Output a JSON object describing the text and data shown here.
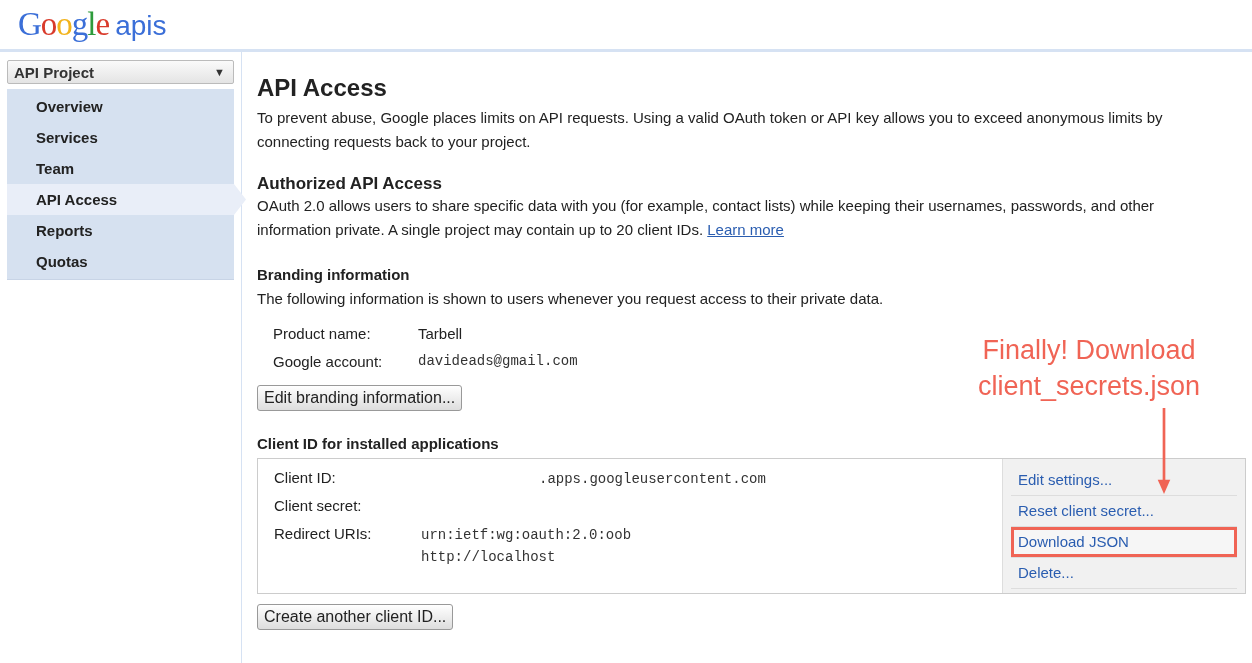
{
  "logo": {
    "brand": "Google",
    "product": "apis"
  },
  "project_select": {
    "value": "API Project",
    "caret": "▼"
  },
  "sidebar": {
    "items": [
      {
        "label": "Overview",
        "selected": false
      },
      {
        "label": "Services",
        "selected": false
      },
      {
        "label": "Team",
        "selected": false
      },
      {
        "label": "API Access",
        "selected": true
      },
      {
        "label": "Reports",
        "selected": false
      },
      {
        "label": "Quotas",
        "selected": false
      }
    ]
  },
  "page": {
    "title": "API Access",
    "intro": "To prevent abuse, Google places limits on API requests. Using a valid OAuth token or API key allows you to exceed anonymous limits by connecting requests back to your project.",
    "authorized": {
      "heading": "Authorized API Access",
      "text": "OAuth 2.0 allows users to share specific data with you (for example, contact lists) while keeping their usernames, passwords, and other information private. A single project may contain up to 20 client IDs.",
      "link": "Learn more"
    },
    "branding": {
      "heading": "Branding information",
      "text": "The following information is shown to users whenever you request access to their private data.",
      "fields": [
        {
          "label": "Product name:",
          "value": "Tarbell",
          "kind": "plain"
        },
        {
          "label": "Google account:",
          "value": "davideads@gmail.com",
          "kind": "mono"
        }
      ],
      "button": "Edit branding information..."
    },
    "client": {
      "heading": "Client ID for installed applications",
      "fields": [
        {
          "label": "Client ID:",
          "values": [
            ".apps.googleusercontent.com"
          ],
          "kind": "id"
        },
        {
          "label": "Client secret:",
          "kind": "plain"
        },
        {
          "label": "Redirect URIs:",
          "values": [
            "urn:ietf:wg:oauth:2.0:oob",
            "http://localhost"
          ],
          "kind": "plain"
        }
      ],
      "actions": [
        {
          "label": "Edit settings...",
          "highlighted": false
        },
        {
          "label": "Reset client secret...",
          "highlighted": false
        },
        {
          "label": "Download JSON",
          "highlighted": true
        },
        {
          "label": "Delete...",
          "highlighted": false
        }
      ],
      "button": "Create another client ID..."
    }
  },
  "annotation": {
    "lines": [
      "Finally! Download",
      "client_secrets.json"
    ]
  }
}
